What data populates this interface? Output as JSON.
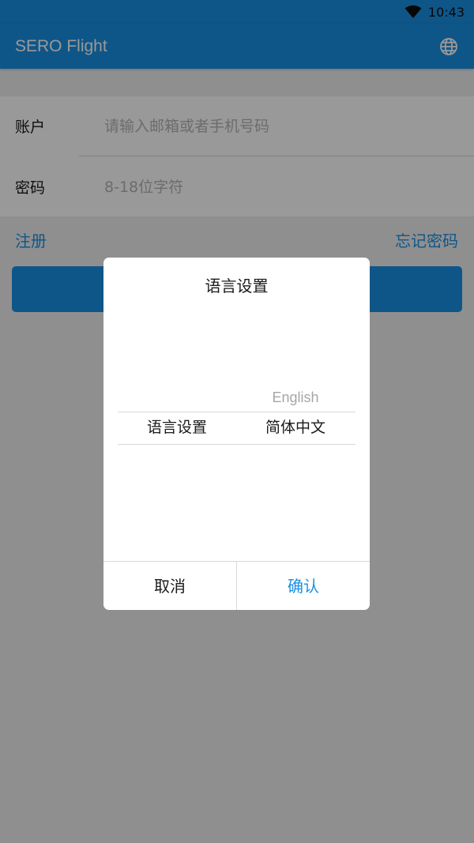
{
  "status_bar": {
    "time": "10:43",
    "wifi_icon": "wifi-icon"
  },
  "app_bar": {
    "title": "SERO Flight",
    "language_icon": "globe-icon"
  },
  "login_form": {
    "account_label": "账户",
    "account_placeholder": "请输入邮箱或者手机号码",
    "account_value": "",
    "password_label": "密码",
    "password_placeholder": "8-18位字符",
    "password_value": "",
    "register_link": "注册",
    "forgot_link": "忘记密码",
    "login_button": ""
  },
  "language_dialog": {
    "title": "语言设置",
    "picker": {
      "column_label": "语言设置",
      "options": [
        "English",
        "简体中文"
      ],
      "selected": "简体中文"
    },
    "cancel_label": "取消",
    "confirm_label": "确认"
  },
  "colors": {
    "primary": "#1a8fe3",
    "overlay": "rgba(0,0,0,0.40)",
    "text": "#1a1a1a",
    "placeholder": "#b5b5b5"
  }
}
